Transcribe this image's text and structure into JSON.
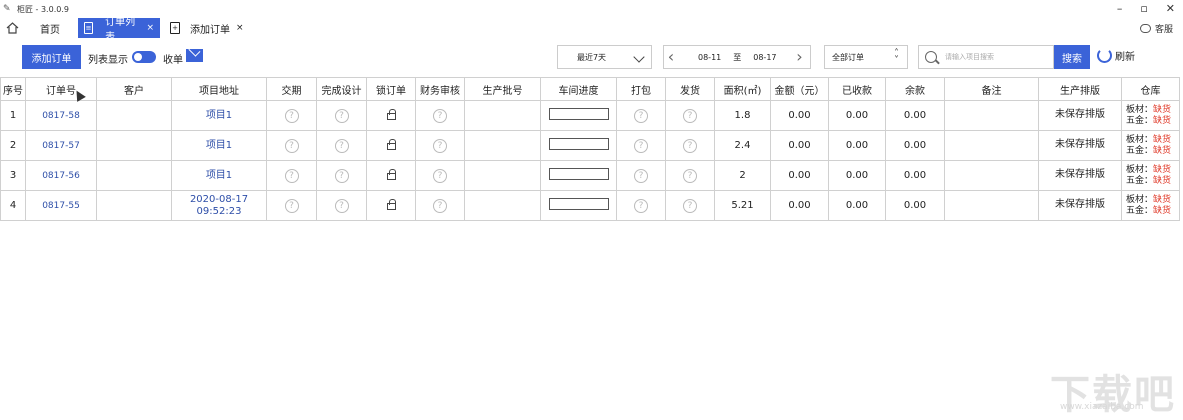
{
  "window": {
    "title": "柜匠 - 3.0.0.9",
    "controls": [
      "–",
      "▫",
      "✕"
    ]
  },
  "tabs": {
    "home": "首页",
    "active": "订单列表",
    "other": "添加订单",
    "close": "×"
  },
  "service": "客服",
  "toolbar": {
    "add_order": "添加订单",
    "list_mode": "列表显示",
    "inbox": "收单",
    "range": "最近7天",
    "date_from": "08-11",
    "date_sep": "至",
    "date_to": "08-17",
    "order_filter": "全部订单",
    "search_placeholder": "请输入项目搜索",
    "search": "搜索",
    "refresh": "刷新"
  },
  "table": {
    "headers": [
      "序号",
      "订单号",
      "客户",
      "项目地址",
      "交期",
      "完成设计",
      "锁订单",
      "财务审核",
      "生产批号",
      "车间进度",
      "打包",
      "发货",
      "面积(㎡)",
      "金额（元）",
      "已收款",
      "余款",
      "备注",
      "生产排版",
      "仓库"
    ],
    "rows": [
      {
        "no": "1",
        "order": "0817-58",
        "customer": "",
        "address": "项目1",
        "address2": "",
        "batch": "",
        "progress": 0,
        "area": "1.8",
        "amount": "0.00",
        "received": "0.00",
        "balance": "0.00",
        "note": "",
        "schedule": "未保存排版",
        "wh_board": "板材：",
        "wh_board_status": "缺货",
        "wh_hw": "五金：",
        "wh_hw_status": "缺货"
      },
      {
        "no": "2",
        "order": "0817-57",
        "customer": "",
        "address": "项目1",
        "address2": "",
        "batch": "",
        "progress": 0,
        "area": "2.4",
        "amount": "0.00",
        "received": "0.00",
        "balance": "0.00",
        "note": "",
        "schedule": "未保存排版",
        "wh_board": "板材：",
        "wh_board_status": "缺货",
        "wh_hw": "五金：",
        "wh_hw_status": "缺货"
      },
      {
        "no": "3",
        "order": "0817-56",
        "customer": "",
        "address": "项目1",
        "address2": "",
        "batch": "",
        "progress": 0,
        "area": "2",
        "amount": "0.00",
        "received": "0.00",
        "balance": "0.00",
        "note": "",
        "schedule": "未保存排版",
        "wh_board": "板材：",
        "wh_board_status": "缺货",
        "wh_hw": "五金：",
        "wh_hw_status": "缺货"
      },
      {
        "no": "4",
        "order": "0817-55",
        "customer": "",
        "address": "2020-08-17",
        "address2": "09:52:23",
        "batch": "",
        "progress": 0,
        "area": "5.21",
        "amount": "0.00",
        "received": "0.00",
        "balance": "0.00",
        "note": "",
        "schedule": "未保存排版",
        "wh_board": "板材：",
        "wh_board_status": "缺货",
        "wh_hw": "五金：",
        "wh_hw_status": "缺货"
      }
    ],
    "q_mark": "?"
  },
  "watermark": {
    "main": "下载吧",
    "sub": "www.xiazaiba.com"
  },
  "colors": {
    "accent": "#3b63d8",
    "link": "#2d4ea8",
    "shortage": "#e03c2c"
  }
}
